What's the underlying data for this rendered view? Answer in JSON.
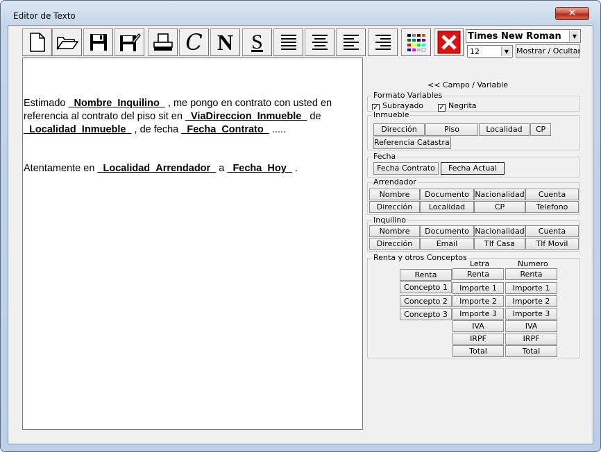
{
  "window": {
    "title": "Editor de Texto",
    "close": "✕"
  },
  "toolbar": {
    "items": [
      {
        "name": "new-document-button",
        "icon": "new-document-icon"
      },
      {
        "name": "open-folder-button",
        "icon": "folder-open-icon"
      },
      {
        "name": "save-button",
        "icon": "floppy-disk-icon"
      },
      {
        "name": "save-as-button",
        "icon": "floppy-edit-icon"
      },
      {
        "name": "print-button",
        "icon": "printer-icon"
      },
      {
        "name": "italic-button",
        "icon": "italic-c-icon",
        "glyph": "C"
      },
      {
        "name": "bold-button",
        "icon": "bold-n-icon",
        "glyph": "N"
      },
      {
        "name": "underline-button",
        "icon": "underline-s-icon",
        "glyph": "S"
      },
      {
        "name": "justify-button",
        "icon": "align-justify-icon"
      },
      {
        "name": "align-center-button",
        "icon": "align-center-icon"
      },
      {
        "name": "align-left-button",
        "icon": "align-left-icon"
      },
      {
        "name": "align-right-button",
        "icon": "align-right-icon"
      },
      {
        "name": "color-button",
        "icon": "color-palette-icon"
      },
      {
        "name": "exit-button",
        "icon": "red-x-icon"
      }
    ],
    "font": "Times New Roman",
    "size": "12",
    "toggle": "Mostrar / Ocultar"
  },
  "doc": {
    "p1": [
      "Estimado ",
      "_Nombre_Inquilino_",
      " , me pongo en contrato con usted en referencia al contrato del piso sit en ",
      "_ViaDireccion_Inmueble_",
      " de ",
      "_Localidad_Inmueble_",
      " , de fecha ",
      "_Fecha_Contrato_",
      " ....."
    ],
    "p2": [
      "Atentamente en ",
      "_Localidad_Arrendador_",
      " a ",
      "_Fecha_Hoy_",
      " ."
    ]
  },
  "panel": {
    "header": "<< Campo / Variable",
    "formato": {
      "legend": "Formato Variables",
      "subrayado": "Subrayado",
      "negrita": "Negrita",
      "check": "✓"
    },
    "inmueble": {
      "legend": "Inmueble",
      "buttons": [
        "Dirección",
        "Piso",
        "Localidad",
        "CP",
        "Referencia Catastral"
      ]
    },
    "fecha": {
      "legend": "Fecha",
      "buttons": [
        "Fecha Contrato",
        "Fecha Actual"
      ]
    },
    "arrendador": {
      "legend": "Arrendador",
      "buttons": [
        "Nombre",
        "Documento",
        "Nacionalidad",
        "Cuenta",
        "Dirección",
        "Localidad",
        "CP",
        "Telefono"
      ]
    },
    "inquilino": {
      "legend": "Inquilino",
      "buttons": [
        "Nombre",
        "Documento",
        "Nacionalidad",
        "Cuenta",
        "Dirección",
        "Email",
        "Tlf Casa",
        "Tlf Movil"
      ]
    },
    "renta": {
      "legend": "Renta y otros Conceptos",
      "letra": "Letra",
      "numero": "Numero",
      "left": [
        "Renta",
        "Concepto 1",
        "Concepto 2",
        "Concepto 3"
      ],
      "letra_btns": [
        "Renta",
        "Importe 1",
        "Importe 2",
        "Importe 3",
        "IVA",
        "IRPF",
        "Total"
      ],
      "numero_btns": [
        "Renta",
        "Importe 1",
        "Importe 2",
        "Importe 3",
        "IVA",
        "IRPF",
        "Total"
      ]
    }
  }
}
